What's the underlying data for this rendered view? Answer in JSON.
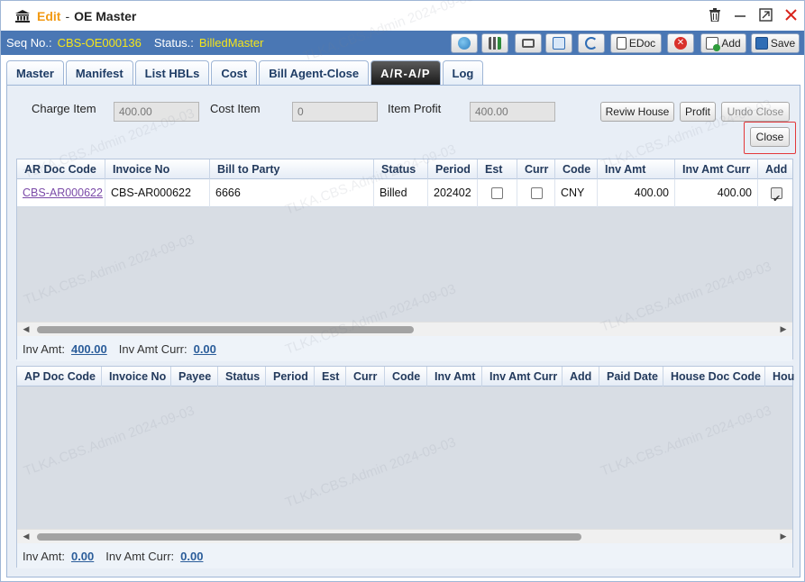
{
  "window": {
    "title_mode": "Edit",
    "title_separator": "-",
    "title_name": "OE Master",
    "controls": {
      "trash_icon": "trash-icon",
      "minimize_icon": "minimize-icon",
      "maximize_icon": "maximize-icon",
      "close_icon": "close-icon"
    }
  },
  "seqbar": {
    "seq_label": "Seq No.:",
    "seq_value": "CBS-OE000136",
    "status_label": "Status.:",
    "status_value": "BilledMaster"
  },
  "toolbar": {
    "edoc_label": "EDoc",
    "add_label": "Add",
    "save_label": "Save"
  },
  "tabs": [
    {
      "label": "Master"
    },
    {
      "label": "Manifest"
    },
    {
      "label": "List HBLs"
    },
    {
      "label": "Cost"
    },
    {
      "label": "Bill Agent-Close"
    },
    {
      "label": "A/R-A/P"
    },
    {
      "label": "Log"
    }
  ],
  "summary": {
    "charge_item_label": "Charge Item",
    "charge_item_value": "400.00",
    "cost_item_label": "Cost Item",
    "cost_item_value": "0",
    "item_profit_label": "Item Profit",
    "item_profit_value": "400.00"
  },
  "actions": {
    "review_house": "Reviw House",
    "profit": "Profit",
    "undo_close": "Undo Close",
    "close": "Close"
  },
  "ar_grid": {
    "headers": [
      "AR Doc Code",
      "Invoice No",
      "Bill to Party",
      "Status",
      "Period",
      "Est",
      "Curr",
      "Code",
      "Inv Amt",
      "Inv Amt Curr",
      "Add"
    ],
    "rows": [
      {
        "doc_code": "CBS-AR000622",
        "invoice_no": "CBS-AR000622",
        "bill_to": "6666",
        "status": "Billed",
        "period": "202402",
        "est": false,
        "curr": false,
        "code": "CNY",
        "inv_amt": "400.00",
        "inv_amt_curr": "400.00",
        "add": true
      }
    ],
    "footer": {
      "inv_amt_label": "Inv Amt:",
      "inv_amt": "400.00",
      "inv_amt_curr_label": "Inv Amt Curr:",
      "inv_amt_curr": "0.00"
    }
  },
  "ap_grid": {
    "headers": [
      "AP Doc Code",
      "Invoice No",
      "Payee",
      "Status",
      "Period",
      "Est",
      "Curr",
      "Code",
      "Inv Amt",
      "Inv Amt Curr",
      "Add",
      "Paid Date",
      "House Doc Code",
      "Hou"
    ],
    "rows": [],
    "footer": {
      "inv_amt_label": "Inv Amt:",
      "inv_amt": "0.00",
      "inv_amt_curr_label": "Inv Amt Curr:",
      "inv_amt_curr": "0.00"
    }
  },
  "watermark_text": "TLKA.CBS.Admin 2024-09-03",
  "colors": {
    "accent": "#4a77b4",
    "title_mode": "#f29a14",
    "status_value": "#f5e51a",
    "highlight": "#e3383a"
  }
}
